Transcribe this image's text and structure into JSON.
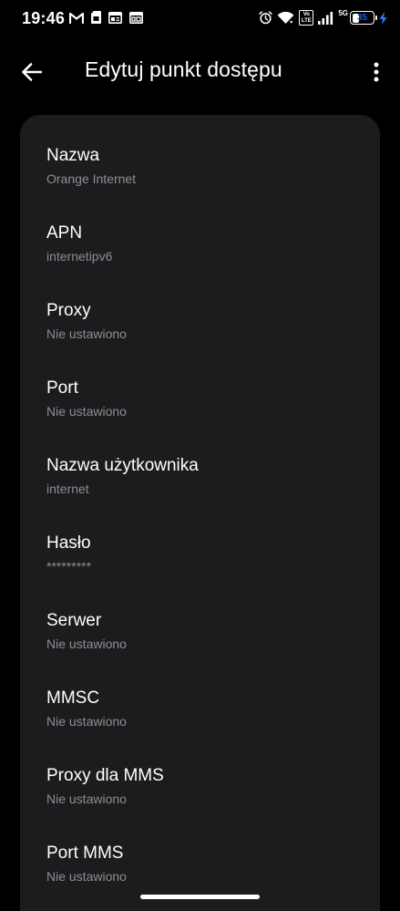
{
  "status_bar": {
    "time": "19:46",
    "left_icons": [
      "gmail-icon",
      "sim-card-icon",
      "news-icon",
      "browser-window-icon"
    ],
    "right_icons": [
      "alarm-icon",
      "wifi-icon",
      "volte-icon",
      "signal-icon",
      "battery-icon",
      "charging-icon"
    ],
    "volte_top": "Vo",
    "volte_bottom": "LTE",
    "network": "5G",
    "battery_level": "35",
    "battery_fraction": 0.35
  },
  "app_bar": {
    "title": "Edytuj punkt dostępu",
    "back_icon": "arrow-back-icon",
    "more_icon": "more-vertical-icon"
  },
  "items": [
    {
      "title": "Nazwa",
      "value": "Orange Internet"
    },
    {
      "title": "APN",
      "value": "internetipv6"
    },
    {
      "title": "Proxy",
      "value": "Nie ustawiono"
    },
    {
      "title": "Port",
      "value": "Nie ustawiono"
    },
    {
      "title": "Nazwa użytkownika",
      "value": "internet"
    },
    {
      "title": "Hasło",
      "value": "*********"
    },
    {
      "title": "Serwer",
      "value": "Nie ustawiono"
    },
    {
      "title": "MMSC",
      "value": "Nie ustawiono"
    },
    {
      "title": "Proxy dla MMS",
      "value": "Nie ustawiono"
    },
    {
      "title": "Port MMS",
      "value": "Nie ustawiono"
    }
  ],
  "colors": {
    "background": "#000000",
    "card": "#1c1c1e",
    "primary_text": "#ffffff",
    "secondary_text": "#8e8e93",
    "charging_accent": "#2f7bff"
  }
}
